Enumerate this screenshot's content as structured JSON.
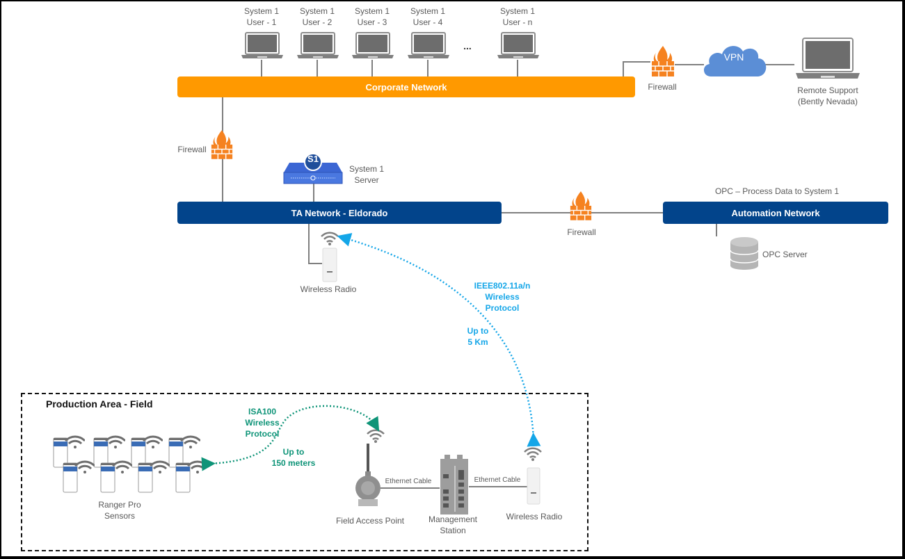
{
  "users": [
    {
      "line1": "System 1",
      "line2": "User - 1"
    },
    {
      "line1": "System 1",
      "line2": "User - 2"
    },
    {
      "line1": "System 1",
      "line2": "User - 3"
    },
    {
      "line1": "System 1",
      "line2": "User - 4"
    },
    {
      "line1": "System 1",
      "line2": "User - n"
    }
  ],
  "ellipsis": "...",
  "networks": {
    "corporate": "Corporate Network",
    "ta": "TA Network - Eldorado",
    "automation": "Automation Network"
  },
  "firewall_label": "Firewall",
  "vpn_label": "VPN",
  "remote_support": {
    "line1": "Remote Support",
    "line2": "(Bently Nevada)"
  },
  "system1_server": {
    "badge": "S1",
    "line1": "System 1",
    "line2": "Server"
  },
  "opc_caption": "OPC – Process Data to System 1",
  "opc_server": "OPC Server",
  "wireless_radio": "Wireless Radio",
  "ieee_link": {
    "line1": "IEEE802.11a/n",
    "line2": "Wireless",
    "line3": "Protocol",
    "range1": "Up to",
    "range2": "5 Km"
  },
  "field": {
    "title": "Production Area - Field",
    "isa_link": {
      "line1": "ISA100",
      "line2": "Wireless",
      "line3": "Protocol",
      "range1": "Up to",
      "range2": "150 meters"
    },
    "sensors": {
      "line1": "Ranger Pro",
      "line2": "Sensors"
    },
    "field_access_point": "Field Access Point",
    "management_station": {
      "line1": "Management",
      "line2": "Station"
    },
    "ethernet_cable": "Ethernet Cable",
    "wireless_radio": "Wireless Radio"
  },
  "colors": {
    "corporate": "#FF9900",
    "network_blue": "#02448B",
    "firewall": "#F58220",
    "vpn_cloud": "#5B8ED6",
    "ieee_link": "#14A6E8",
    "isa_link": "#0E9478"
  }
}
